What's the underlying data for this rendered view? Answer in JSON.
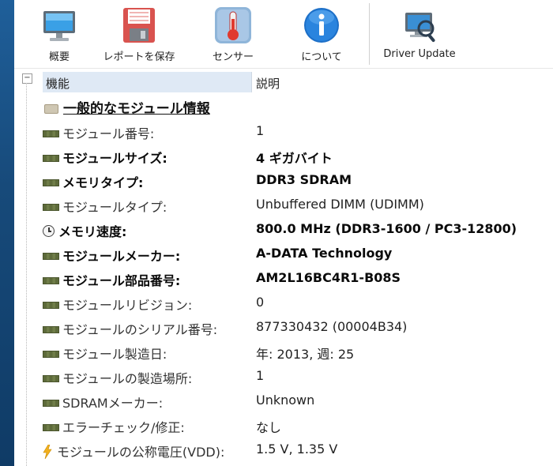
{
  "toolbar": {
    "buttons": [
      {
        "label": "概要",
        "icon": "monitor-icon"
      },
      {
        "label": "レポートを保存",
        "icon": "floppy-icon"
      },
      {
        "label": "センサー",
        "icon": "thermometer-icon"
      },
      {
        "label": "について",
        "icon": "info-icon"
      },
      {
        "label": "Driver Update",
        "icon": "driver-update-icon"
      }
    ]
  },
  "tree": {
    "collapse_symbol": "−"
  },
  "header": {
    "col1": "機能",
    "col2": "説明"
  },
  "section": {
    "title": "一般的なモジュール情報"
  },
  "rows": [
    {
      "name": "モジュール番号:",
      "value": "1",
      "bold": false,
      "icon": "ram-icon"
    },
    {
      "name": "モジュールサイズ:",
      "value": "4 ギガバイト",
      "bold": true,
      "icon": "ram-icon"
    },
    {
      "name": "メモリタイプ:",
      "value": "DDR3 SDRAM",
      "bold": true,
      "icon": "ram-icon"
    },
    {
      "name": "モジュールタイプ:",
      "value": "Unbuffered DIMM (UDIMM)",
      "bold": false,
      "icon": "ram-icon"
    },
    {
      "name": "メモリ速度:",
      "value": "800.0 MHz (DDR3-1600 / PC3-12800)",
      "bold": true,
      "icon": "clock-icon"
    },
    {
      "name": "モジュールメーカー:",
      "value": "A-DATA Technology",
      "bold": true,
      "icon": "ram-icon"
    },
    {
      "name": "モジュール部品番号:",
      "value": "AM2L16BC4R1-B08S",
      "bold": true,
      "icon": "ram-icon"
    },
    {
      "name": "モジュールリビジョン:",
      "value": "0",
      "bold": false,
      "icon": "ram-icon"
    },
    {
      "name": "モジュールのシリアル番号:",
      "value": "877330432 (00004B34)",
      "bold": false,
      "icon": "ram-icon"
    },
    {
      "name": "モジュール製造日:",
      "value": "年: 2013, 週: 25",
      "bold": false,
      "icon": "ram-icon"
    },
    {
      "name": "モジュールの製造場所:",
      "value": "1",
      "bold": false,
      "icon": "ram-icon"
    },
    {
      "name": "SDRAMメーカー:",
      "value": "Unknown",
      "bold": false,
      "icon": "ram-icon"
    },
    {
      "name": "エラーチェック/修正:",
      "value": "なし",
      "bold": false,
      "icon": "ram-icon"
    },
    {
      "name": "モジュールの公称電圧(VDD):",
      "value": "1.5 V, 1.35 V",
      "bold": false,
      "icon": "bolt-icon"
    }
  ],
  "colors": {
    "header_highlight": "#dfe9f5",
    "left_strip": "#174a7a"
  }
}
